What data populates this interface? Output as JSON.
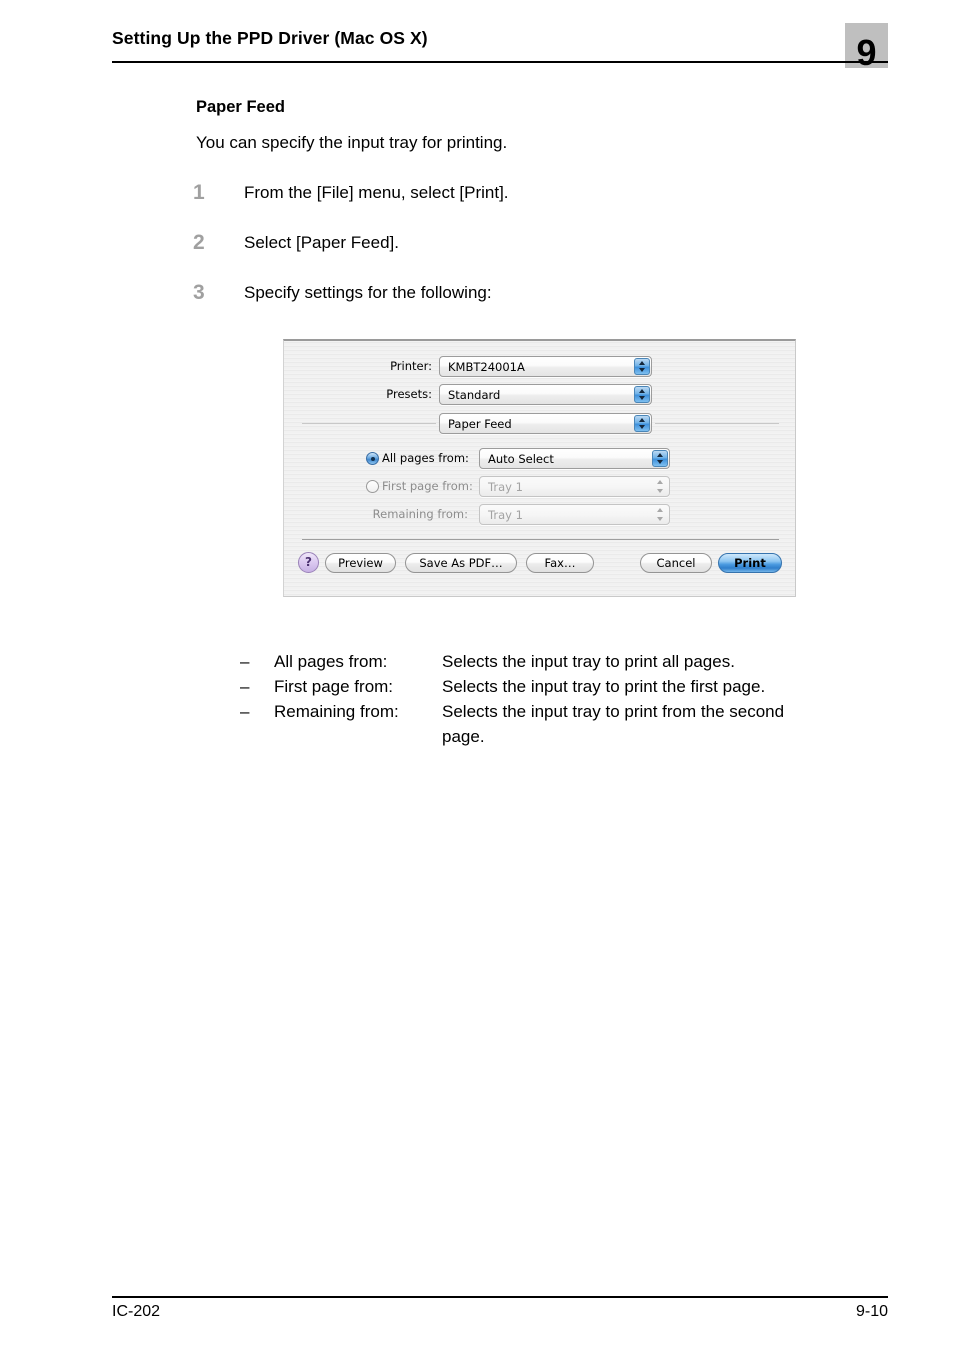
{
  "header": {
    "title": "Setting Up the PPD Driver (Mac OS X)",
    "chapter_number": "9"
  },
  "section": {
    "heading": "Paper Feed",
    "intro": "You can specify the input tray for printing."
  },
  "steps": [
    {
      "number": "1",
      "text": "From the [File] menu, select [Print]."
    },
    {
      "number": "2",
      "text": "Select [Paper Feed]."
    },
    {
      "number": "3",
      "text": "Specify settings for the following:"
    }
  ],
  "print_dialog": {
    "printer": {
      "label": "Printer:",
      "value": "KMBT24001A"
    },
    "presets": {
      "label": "Presets:",
      "value": "Standard"
    },
    "pane": {
      "value": "Paper Feed"
    },
    "all_pages": {
      "label": "All pages from:",
      "value": "Auto Select",
      "selected": true
    },
    "first_page": {
      "label": "First page from:",
      "value": "Tray 1",
      "selected": false
    },
    "remaining": {
      "label": "Remaining from:",
      "value": "Tray 1"
    },
    "buttons": {
      "help": "?",
      "preview": "Preview",
      "save_as_pdf": "Save As PDF…",
      "fax": "Fax…",
      "cancel": "Cancel",
      "print": "Print"
    },
    "colors": {
      "accent_blue": "#3f86cd",
      "help_purple": "#c7b0e4",
      "dialog_background": "#f1f1f1"
    }
  },
  "definitions": [
    {
      "dash": "–",
      "term": "All pages from:",
      "description": "Selects the input tray to print all pages."
    },
    {
      "dash": "–",
      "term": "First page from:",
      "description": "Selects the input tray to print the first page."
    },
    {
      "dash": "–",
      "term": "Remaining from:",
      "description": "Selects the input tray to print from the second",
      "continuation": "page."
    }
  ],
  "footer": {
    "left": "IC-202",
    "right": "9-10"
  }
}
